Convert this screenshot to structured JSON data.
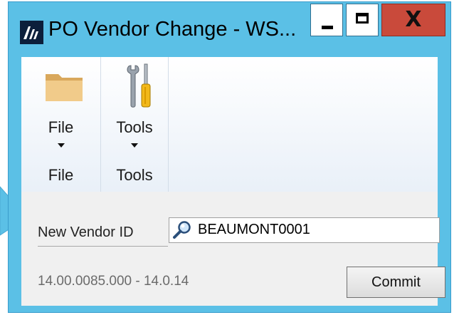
{
  "window": {
    "title": "PO Vendor Change  -  WS...",
    "controls": {
      "minimize_icon": "minimize-icon",
      "maximize_icon": "maximize-icon",
      "close_label": "X"
    }
  },
  "ribbon": {
    "groups": [
      {
        "button_label": "File",
        "group_label": "File",
        "icon": "folder-icon"
      },
      {
        "button_label": "Tools",
        "group_label": "Tools",
        "icon": "tools-icon"
      }
    ]
  },
  "form": {
    "vendor_label": "New Vendor ID",
    "vendor_value": "BEAUMONT0001",
    "lookup_icon": "lookup-icon",
    "version": "14.00.0085.000 - 14.0.14",
    "commit_label": "Commit"
  },
  "colors": {
    "frame": "#5bc0e6",
    "close_button": "#c94a3b",
    "ribbon_bg": "#ffffff",
    "content_bg": "#f0f0f0"
  }
}
